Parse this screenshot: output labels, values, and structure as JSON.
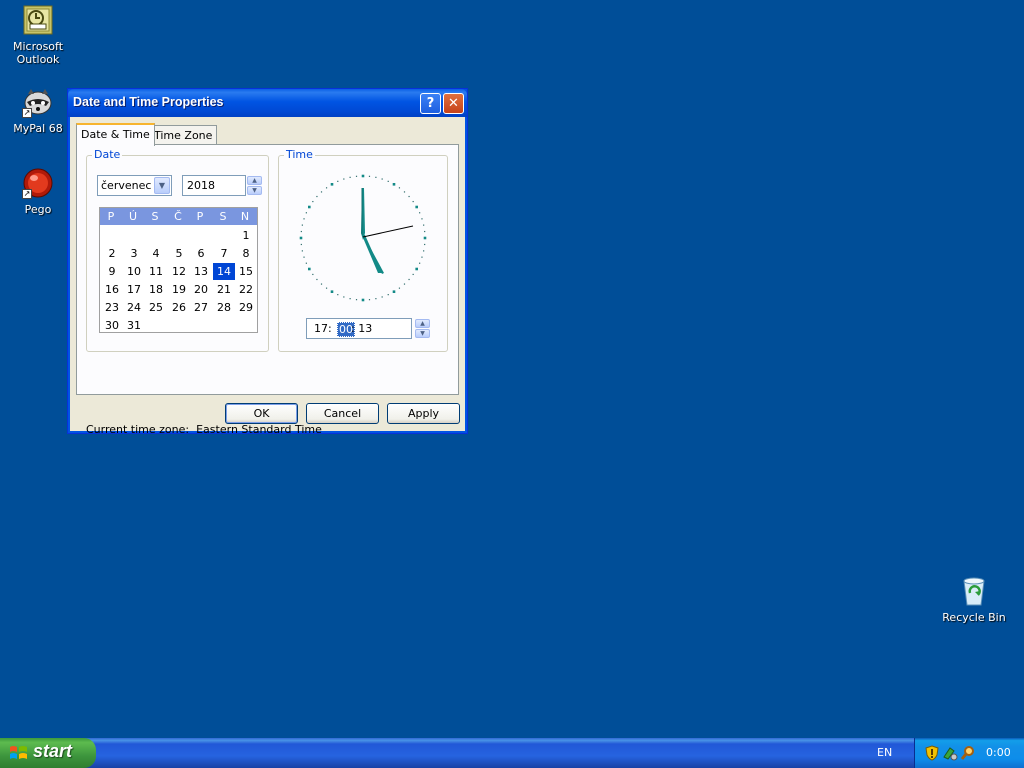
{
  "desktop": {
    "icons": [
      {
        "label_line1": "Microsoft",
        "label_line2": "Outlook"
      },
      {
        "label_line1": "MyPal 68",
        "label_line2": ""
      },
      {
        "label_line1": "Pego",
        "label_line2": ""
      }
    ],
    "recycle_bin": "Recycle Bin"
  },
  "dialog": {
    "title": "Date and Time Properties",
    "help_glyph": "?",
    "close_glyph": "✕",
    "tabs": [
      {
        "label": "Date & Time"
      },
      {
        "label": "Time Zone"
      }
    ],
    "date_group": "Date",
    "time_group": "Time",
    "month_value": "červenec",
    "year_value": "2018",
    "weekday_headers": [
      "P",
      "Ú",
      "S",
      "Č",
      "P",
      "S",
      "N"
    ],
    "calendar_rows": [
      [
        "",
        "",
        "",
        "",
        "",
        "",
        "1"
      ],
      [
        "2",
        "3",
        "4",
        "5",
        "6",
        "7",
        "8"
      ],
      [
        "9",
        "10",
        "11",
        "12",
        "13",
        "14",
        "15"
      ],
      [
        "16",
        "17",
        "18",
        "19",
        "20",
        "21",
        "22"
      ],
      [
        "23",
        "24",
        "25",
        "26",
        "27",
        "28",
        "29"
      ],
      [
        "30",
        "31",
        "",
        "",
        "",
        "",
        ""
      ]
    ],
    "selected_day": "14",
    "time_hours": "17:",
    "time_minutes": "00",
    "time_seconds": ": 13",
    "current_tz_label": "Current time zone:",
    "current_tz_value": "Eastern Standard Time",
    "buttons": {
      "ok": "OK",
      "cancel": "Cancel",
      "apply": "Apply"
    }
  },
  "taskbar": {
    "start_label": "start",
    "language": "EN",
    "clock": "0:00"
  },
  "colors": {
    "desktop": "#004e98",
    "title_blue": "#0054e3",
    "calendar_header": "#7a96df",
    "selected_day": "#0046d5",
    "clock_hands": "#138a87"
  }
}
